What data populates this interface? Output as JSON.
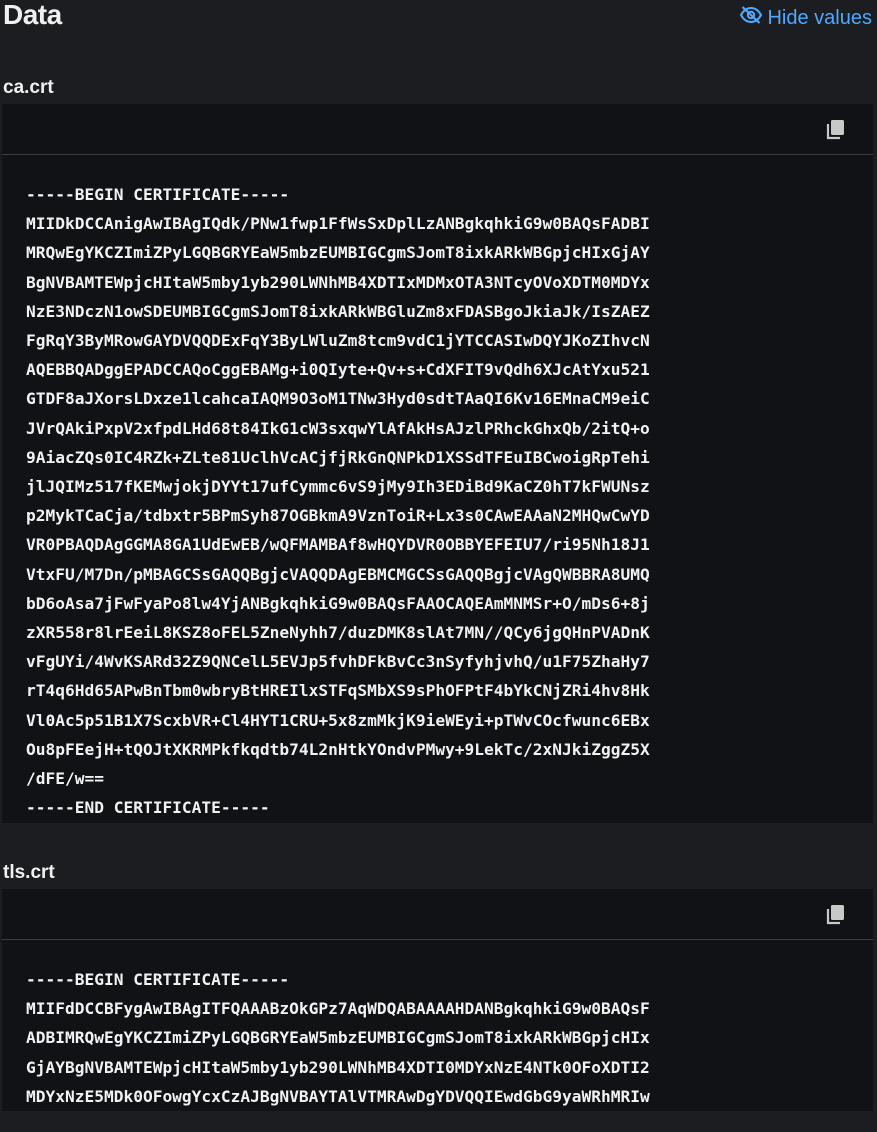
{
  "header": {
    "title": "Data",
    "hide_values_label": "Hide values"
  },
  "sections": [
    {
      "label": "ca.crt",
      "content": "-----BEGIN CERTIFICATE-----\nMIIDkDCCAnigAwIBAgIQdk/PNw1fwp1FfWsSxDplLzANBgkqhkiG9w0BAQsFADBI\nMRQwEgYKCZImiZPyLGQBGRYEaW5mbzEUMBIGCgmSJomT8ixkARkWBGpjcHIxGjAY\nBgNVBAMTEWpjcHItaW5mby1yb290LWNhMB4XDTIxMDMxOTA3NTcyOVoXDTM0MDYx\nNzE3NDczN1owSDEUMBIGCgmSJomT8ixkARkWBGluZm8xFDASBgoJkiaJk/IsZAEZ\nFgRqY3ByMRowGAYDVQQDExFqY3ByLWluZm8tcm9vdC1jYTCCASIwDQYJKoZIhvcN\nAQEBBQADggEPADCCAQoCggEBAMg+i0QIyte+Qv+s+CdXFIT9vQdh6XJcAtYxu521\nGTDF8aJXorsLDxze1lcahcaIAQM9O3oM1TNw3Hyd0sdtTAaQI6Kv16EMnaCM9eiC\nJVrQAkiPxpV2xfpdLHd68t84IkG1cW3sxqwYlAfAkHsAJzlPRhckGhxQb/2itQ+o\n9AiacZQs0IC4RZk+ZLte81UclhVcACjfjRkGnQNPkD1XSSdTFEuIBCwoigRpTehi\njlJQIMz517fKEMwjokjDYYt17ufCymmc6vS9jMy9Ih3EDiBd9KaCZ0hT7kFWUNsz\np2MykTCaCja/tdbxtr5BPmSyh87OGBkmA9VznToiR+Lx3s0CAwEAAaN2MHQwCwYD\nVR0PBAQDAgGGMA8GA1UdEwEB/wQFMAMBAf8wHQYDVR0OBBYEFEIU7/ri95Nh18J1\nVtxFU/M7Dn/pMBAGCSsGAQQBgjcVAQQDAgEBMCMGCSsGAQQBgjcVAgQWBBRA8UMQ\nbD6oAsa7jFwFyaPo8lw4YjANBgkqhkiG9w0BAQsFAAOCAQEAmMNMSr+O/mDs6+8j\nzXR558r8lrEeiL8KSZ8oFEL5ZneNyhh7/duzDMK8slAt7MN//QCy6jgQHnPVADnK\nvFgUYi/4WvKSARd32Z9QNCelL5EVJp5fvhDFkBvCc3nSyfyhjvhQ/u1F75ZhaHy7\nrT4q6Hd65APwBnTbm0wbryBtHREIlxSTFqSMbXS9sPhOFPtF4bYkCNjZRi4hv8Hk\nVl0Ac5p51B1X7ScxbVR+Cl4HYT1CRU+5x8zmMkjK9ieWEyi+pTWvCOcfwunc6EBx\nOu8pFEejH+tQOJtXKRMPkfkqdtb74L2nHtkYOndvPMwy+9LekTc/2xNJkiZggZ5X\n/dFE/w==\n-----END CERTIFICATE-----"
    },
    {
      "label": "tls.crt",
      "content": "-----BEGIN CERTIFICATE-----\nMIIFdDCCBFygAwIBAgITFQAAABzOkGPz7AqWDQABAAAAHDANBgkqhkiG9w0BAQsF\nADBIMRQwEgYKCZImiZPyLGQBGRYEaW5mbzEUMBIGCgmSJomT8ixkARkWBGpjcHIx\nGjAYBgNVBAMTEWpjcHItaW5mby1yb290LWNhMB4XDTI0MDYxNzE4NTk0OFoXDTI2\nMDYxNzE5MDk0OFowgYcxCzAJBgNVBAYTAlVTMRAwDgYDVQQIEwdGbG9yaWRhMRIw"
    }
  ],
  "colors": {
    "background": "#1b1d21",
    "code_background": "#101216",
    "accent": "#4fa8ff"
  },
  "icons": {
    "hide": "eye-slash-icon",
    "copy": "copy-icon"
  }
}
